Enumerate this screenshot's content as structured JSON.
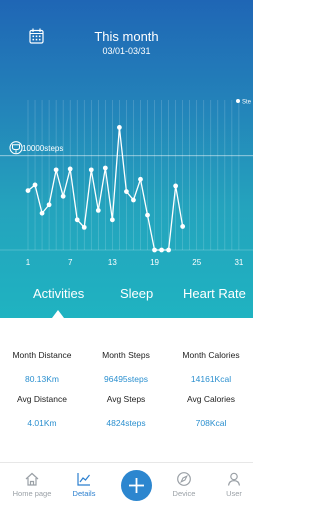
{
  "header": {
    "title": "This month",
    "date_range": "03/01-03/31",
    "goal_label": "10000steps",
    "legend": "Ste"
  },
  "chart_data": {
    "type": "line",
    "x": [
      1,
      2,
      3,
      4,
      5,
      6,
      7,
      8,
      9,
      10,
      11,
      12,
      13,
      14,
      15,
      16,
      17,
      18,
      19,
      20,
      21,
      22,
      23
    ],
    "values": [
      6300,
      6900,
      3900,
      4800,
      8500,
      5700,
      8600,
      3200,
      2400,
      8500,
      4200,
      8700,
      3200,
      13000,
      6200,
      5300,
      7500,
      3700,
      0,
      0,
      0,
      6800,
      2500
    ],
    "goal": 10000,
    "ylim": [
      0,
      14000
    ],
    "x_ticks": [
      "1",
      "7",
      "13",
      "19",
      "25",
      "31"
    ],
    "grid": true
  },
  "tabs": [
    "Activities",
    "Sleep",
    "Heart Rate"
  ],
  "active_tab": "Activities",
  "stats": {
    "month_distance_label": "Month Distance",
    "month_distance_value": "80.13Km",
    "month_steps_label": "Month Steps",
    "month_steps_value": "96495steps",
    "month_calories_label": "Month Calories",
    "month_calories_value": "14161Kcal",
    "avg_distance_label": "Avg Distance",
    "avg_distance_value": "4.01Km",
    "avg_steps_label": "Avg Steps",
    "avg_steps_value": "4824steps",
    "avg_calories_label": "Avg Calories",
    "avg_calories_value": "708Kcal"
  },
  "nav": {
    "home": "Home page",
    "details": "Details",
    "device": "Device",
    "user": "User"
  },
  "colors": {
    "accent": "#2b7fcf",
    "value_text": "#2a8fcf"
  }
}
